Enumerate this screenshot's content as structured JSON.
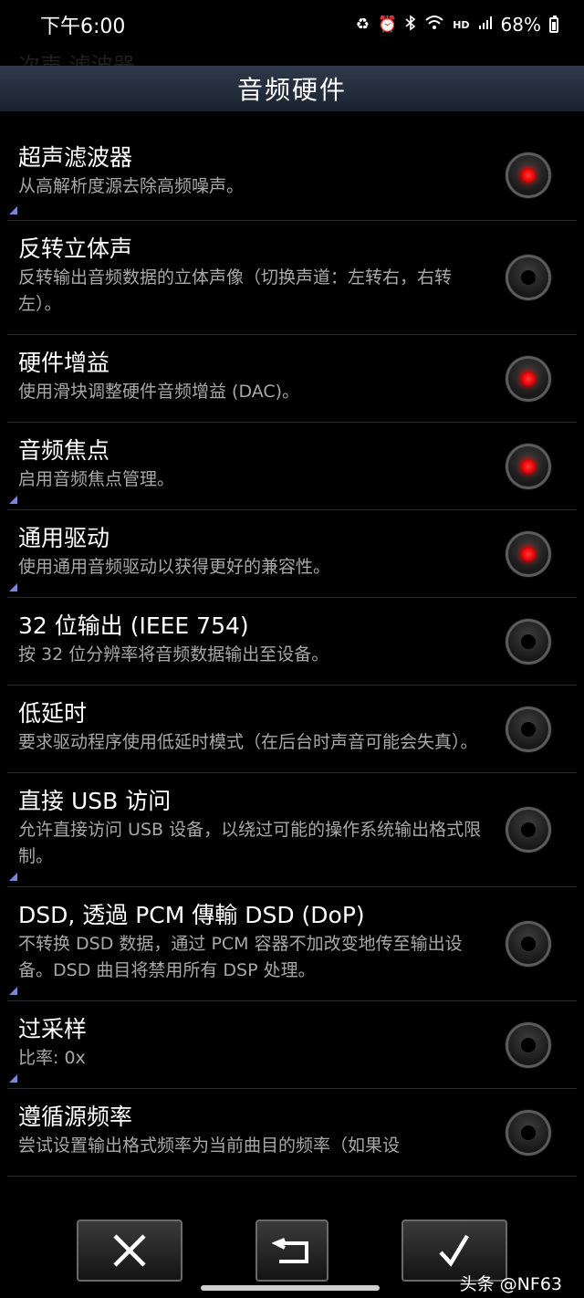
{
  "status_bar": {
    "time": "下午6:00",
    "hd": "HD",
    "battery_percent": "68%",
    "icons": [
      "recycle-icon",
      "alarm-icon",
      "bluetooth-icon",
      "wifi-icon",
      "hd-icon",
      "signal-icon",
      "battery-icon"
    ]
  },
  "ghost_title": "次声 滤波器",
  "header": {
    "title": "音频硬件"
  },
  "settings": [
    {
      "title": "超声滤波器",
      "desc": "从高解析度源去除高频噪声。",
      "checked": true,
      "mark": true
    },
    {
      "title": "反转立体声",
      "desc": "反转输出音频数据的立体声像（切换声道：左转右，右转左）。",
      "checked": false,
      "mark": false
    },
    {
      "title": "硬件增益",
      "desc": "使用滑块调整硬件音频增益 (DAC)。",
      "checked": true,
      "mark": false
    },
    {
      "title": "音频焦点",
      "desc": "启用音频焦点管理。",
      "checked": true,
      "mark": true
    },
    {
      "title": "通用驱动",
      "desc": "使用通用音频驱动以获得更好的兼容性。",
      "checked": true,
      "mark": true
    },
    {
      "title": "32 位输出 (IEEE 754)",
      "desc": "按 32 位分辨率将音频数据输出至设备。",
      "checked": false,
      "mark": false
    },
    {
      "title": "低延时",
      "desc": "要求驱动程序使用低延时模式（在后台时声音可能会失真）。",
      "checked": false,
      "mark": false
    },
    {
      "title": "直接 USB 访问",
      "desc": "允许直接访问 USB 设备，以绕过可能的操作系统输出格式限制。",
      "checked": false,
      "mark": true
    },
    {
      "title": "DSD, 透過 PCM 傳輸 DSD (DoP)",
      "desc": "不转换 DSD 数据，通过 PCM 容器不加改变地传至输出设备。DSD 曲目将禁用所有 DSP 处理。",
      "checked": false,
      "mark": true
    },
    {
      "title": "过采样",
      "desc": "比率: 0x",
      "checked": false,
      "mark": true
    },
    {
      "title": "遵循源频率",
      "desc": "尝试设置输出格式频率为当前曲目的频率（如果设",
      "checked": false,
      "mark": false
    }
  ],
  "buttons": {
    "cancel_icon": "close-icon",
    "undo_icon": "undo-icon",
    "confirm_icon": "check-icon"
  },
  "watermark": "头条 @NF63",
  "colors": {
    "header_bg": "#24303f",
    "radio_on": "#ff1a1a",
    "desc_text": "#a8a8a8"
  }
}
